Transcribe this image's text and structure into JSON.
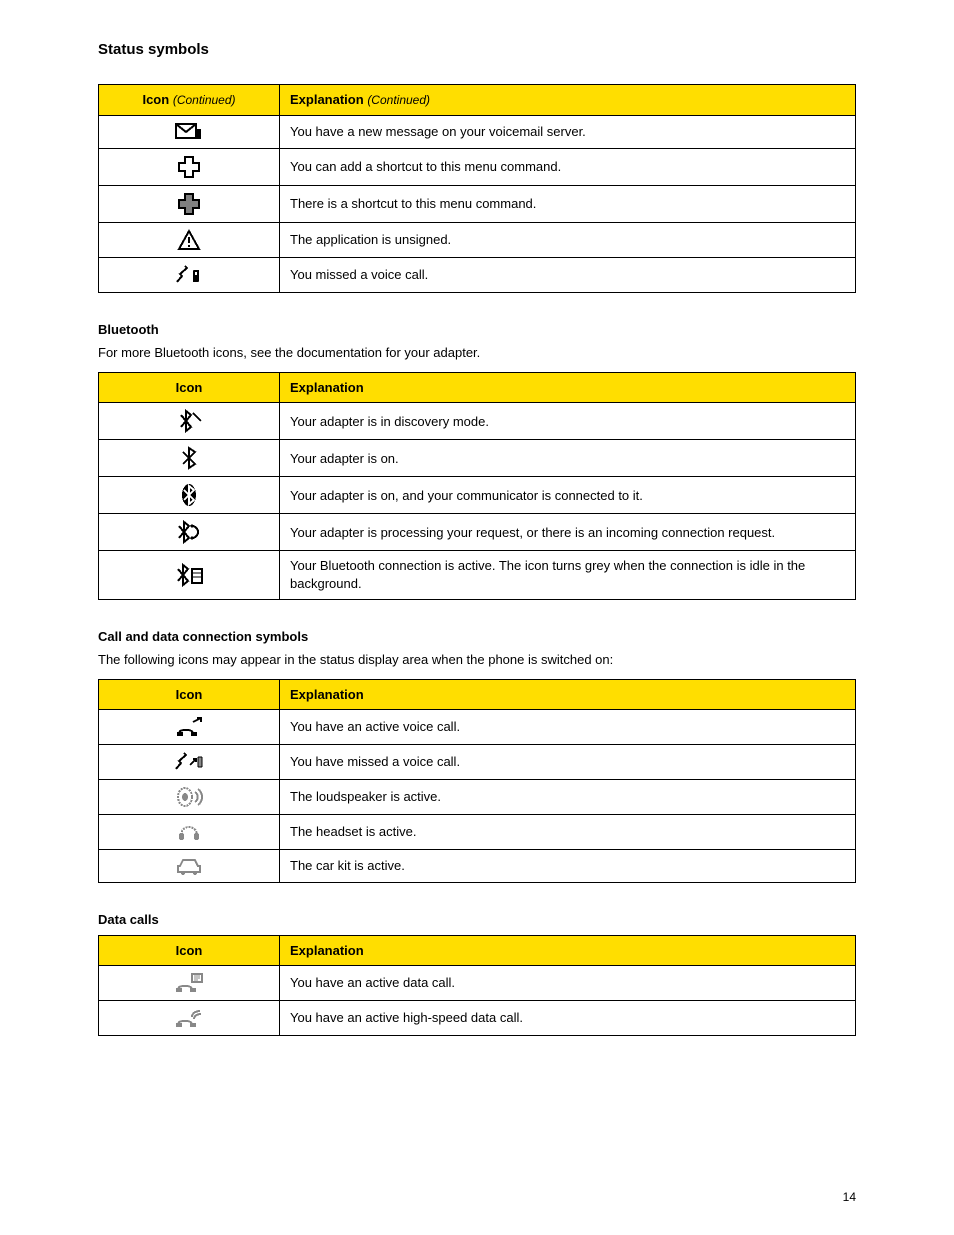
{
  "page": {
    "title": "Status symbols",
    "number": "14"
  },
  "continued_label": "(Continued)",
  "tables": {
    "main": {
      "headers": {
        "icon": "Icon",
        "explanation": "Explanation"
      },
      "rows": {
        "r0": "You have a new message on your voicemail server.",
        "r1": "You can add a shortcut to this menu command.",
        "r2": "There is a shortcut to this menu command.",
        "r3": "The application is unsigned.",
        "r4": "You missed a voice call."
      }
    },
    "bluetooth": {
      "title": "Bluetooth",
      "desc": "For more Bluetooth icons, see the documentation for your adapter.",
      "headers": {
        "icon": "Icon",
        "explanation": "Explanation"
      },
      "rows": {
        "r0": "Your adapter is in discovery mode.",
        "r1": "Your adapter is on.",
        "r2": "Your adapter is on, and your communicator is connected to it.",
        "r3": "Your adapter is processing your request, or there is an incoming connection request.",
        "r4": "Your Bluetooth connection is active. The icon turns grey when the connection is idle in the background."
      }
    },
    "call_data": {
      "title": "Call and data connection symbols",
      "desc": "The following icons may appear in the status display area when the phone is switched on:",
      "headers": {
        "icon": "Icon",
        "explanation": "Explanation"
      },
      "rows": {
        "r0": "You have an active voice call.",
        "r1": "You have missed a voice call.",
        "r2": "The loudspeaker is active.",
        "r3": "The headset is active.",
        "r4": "The car kit is active."
      }
    },
    "data_calls": {
      "title": "Data calls",
      "headers": {
        "icon": "Icon",
        "explanation": "Explanation"
      },
      "rows": {
        "r0": "You have an active data call.",
        "r1": "You have an active high-speed data call."
      }
    }
  }
}
